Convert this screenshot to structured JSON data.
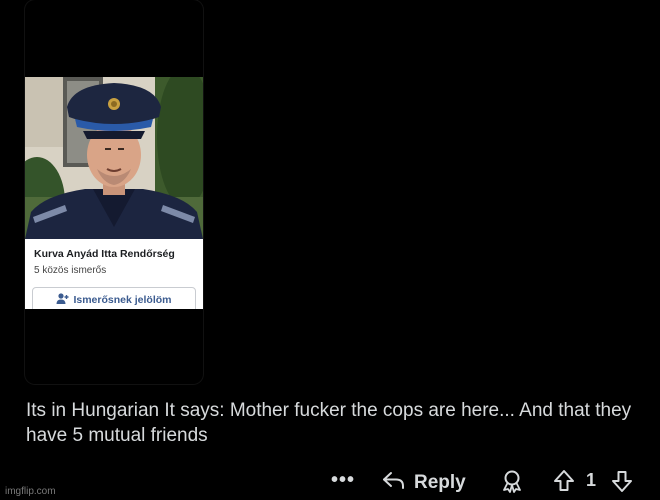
{
  "post_image": {
    "profile_name": "Kurva Anyád Itta Rendőrség",
    "mutual_friends": "5 közös ismerős",
    "add_friend_label": "Ismerősnek jelölöm"
  },
  "comment": {
    "text": "Its in Hungarian It says: Mother fucker the cops are here... And that they have 5 mutual friends"
  },
  "actions": {
    "more_label": "•••",
    "reply_label": "Reply",
    "vote_count": "1"
  },
  "watermark": "imgflip.com",
  "icons": [
    "overflow-menu-icon",
    "reply-arrow-icon",
    "award-icon",
    "upvote-arrow-icon",
    "downvote-arrow-icon",
    "person-add-icon"
  ],
  "colors": {
    "background": "#000000",
    "text": "#d7dadc",
    "fb_link": "#3b5b8f"
  }
}
